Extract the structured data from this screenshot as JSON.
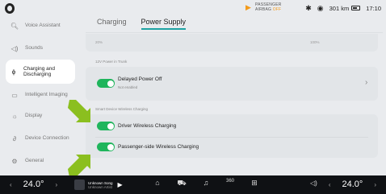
{
  "status_bar": {
    "airbag_line1": "PASSENGER",
    "airbag_line2_prefix": "AIRBAG ",
    "airbag_status": "OFF",
    "range": "301 km",
    "time": "17:10"
  },
  "sidebar": {
    "items": [
      {
        "label": "Voice Assistant",
        "icon": "voice-assistant-icon"
      },
      {
        "label": "Sounds",
        "icon": "speaker-icon"
      },
      {
        "label": "Charging and Discharging",
        "icon": "charging-plug-icon"
      },
      {
        "label": "Intelligent Imaging",
        "icon": "camera-icon"
      },
      {
        "label": "Display",
        "icon": "brightness-icon"
      },
      {
        "label": "Device Connection",
        "icon": "link-icon"
      },
      {
        "label": "General",
        "icon": "gear-icon"
      }
    ],
    "active_index": 2
  },
  "tabs": [
    {
      "label": "Charging",
      "active": false
    },
    {
      "label": "Power Supply",
      "active": true
    }
  ],
  "slider": {
    "left_label": "20%",
    "right_label": "100%"
  },
  "truck_power": {
    "section_label": "12V Power in Trunk",
    "title": "Delayed Power Off",
    "subtitle": "Not enabled",
    "enabled": true
  },
  "wireless": {
    "section_label": "Smart Device Wireless Charging",
    "driver_label": "Driver Wireless Charging",
    "driver_enabled": true,
    "passenger_label": "Passenger-side Wireless Charging",
    "passenger_enabled": true
  },
  "bottom_bar": {
    "temp_left": "24.0°",
    "temp_right": "24.0°",
    "song_title": "Unknown Song",
    "song_artist": "Unknown Artist",
    "dock_icons": [
      "home-icon",
      "car-icon",
      "music-icon",
      "360-view-icon",
      "apps-grid-icon"
    ],
    "dock_360_label": "360"
  },
  "colors": {
    "accent": "#1ea3a3",
    "toggle_on": "#1fb55c",
    "airbag_off": "#f39a1a",
    "arrow": "#8bbf1f"
  }
}
